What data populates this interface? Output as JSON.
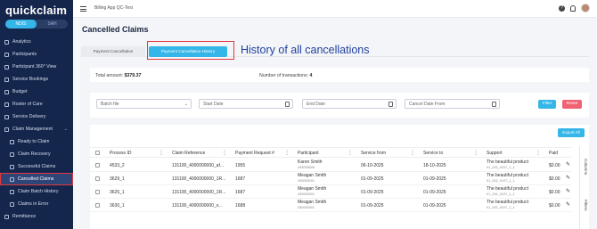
{
  "sidebar": {
    "logo": "quickclaim",
    "toggle": [
      "NDIS",
      "SAH"
    ],
    "items": [
      {
        "label": "Analytics",
        "sub": false
      },
      {
        "label": "Participants",
        "sub": false
      },
      {
        "label": "Participant 360° View",
        "sub": false
      },
      {
        "label": "Service Bookings",
        "sub": false
      },
      {
        "label": "Budget",
        "sub": false
      },
      {
        "label": "Roster of Care",
        "sub": false
      },
      {
        "label": "Service Delivery",
        "sub": false
      },
      {
        "label": "Claim Management",
        "sub": false,
        "chevron": "⌄"
      },
      {
        "label": "Ready to Claim",
        "sub": true
      },
      {
        "label": "Claim Recovery",
        "sub": true
      },
      {
        "label": "Successful Claims",
        "sub": true
      },
      {
        "label": "Cancelled Claims",
        "sub": true,
        "active": true
      },
      {
        "label": "Claim Batch History",
        "sub": true
      },
      {
        "label": "Claims in Error",
        "sub": true
      },
      {
        "label": "Remittance",
        "sub": false
      }
    ]
  },
  "topbar": {
    "app_title": "Billing App QC-Test",
    "help_glyph": "?"
  },
  "page": {
    "title": "Cancelled Claims",
    "tabs": [
      "Payment Cancellation",
      "Payment Cancellation History"
    ],
    "annotation": "History of all cancellations"
  },
  "summary": {
    "total_label": "Total amount:",
    "total_value": "$379.37",
    "count_label": "Number of transactions:",
    "count_value": "4"
  },
  "filters": {
    "batch": "Batch file",
    "batch_chevron": "⌄",
    "start": "Start Date",
    "end": "End Date",
    "cancel_from": "Cancel Date From",
    "filter_btn": "Filter",
    "reset_btn": "Reset"
  },
  "table": {
    "export_label": "Export All",
    "columns": [
      "Process ID",
      "Claim Reference",
      "Payment Request #",
      "Participant",
      "Service from",
      "Service to",
      "Support",
      "Paid"
    ],
    "rows": [
      {
        "process_id": "4533_2",
        "claim_ref": "131100_4000000000_af...",
        "payment_req": "1955",
        "participant": "Karen Smith",
        "participant_id": "433006608",
        "service_from": "06-10-2025",
        "service_to": "18-10-2025",
        "support": "The beautiful product",
        "support_code": "01_002_0107_1_1",
        "paid": "$0.00"
      },
      {
        "process_id": "3629_1",
        "claim_ref": "131100_4000000000_1R...",
        "payment_req": "1687",
        "participant": "Meagan Smith",
        "participant_id": "430000001",
        "service_from": "01-09-2025",
        "service_to": "01-09-2025",
        "support": "The beautiful product",
        "support_code": "01_002_0107_1_1",
        "paid": "$0.00"
      },
      {
        "process_id": "3626_1",
        "claim_ref": "131100_4000000000_1R...",
        "payment_req": "1687",
        "participant": "Meagan Smith",
        "participant_id": "430000001",
        "service_from": "01-09-2025",
        "service_to": "01-09-2025",
        "support": "The beautiful product",
        "support_code": "01_002_0107_1_1",
        "paid": "$0.00"
      },
      {
        "process_id": "3630_1",
        "claim_ref": "131100_4000000000_v...",
        "payment_req": "1688",
        "participant": "Meagan Smith",
        "participant_id": "430000001",
        "service_from": "01-09-2025",
        "service_to": "01-09-2025",
        "support": "The beautiful product",
        "support_code": "01_002_0107_1_1",
        "paid": "$0.00"
      }
    ],
    "rail": [
      "Columns",
      "Filters"
    ]
  }
}
